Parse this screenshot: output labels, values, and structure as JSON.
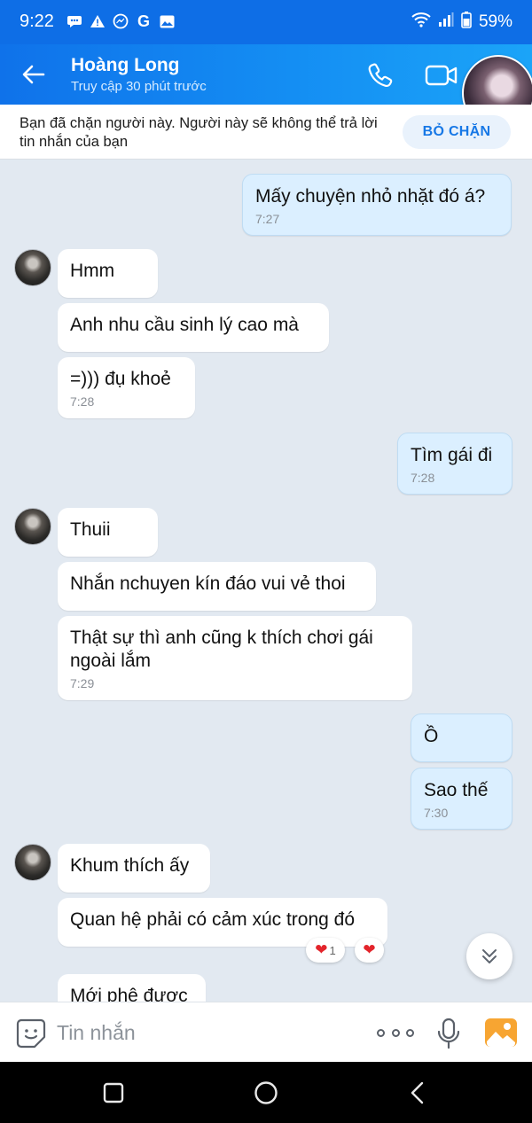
{
  "status": {
    "time": "9:22",
    "battery": "59%",
    "notification_icons": [
      "chat-bubble-icon",
      "warning-icon",
      "messenger-icon",
      "google-icon",
      "image-icon"
    ]
  },
  "header": {
    "name": "Hoàng Long",
    "status": "Truy cập 30 phút trước"
  },
  "banner": {
    "text": "Bạn đã chặn người này. Người này sẽ không thể trả lời tin nhắn của bạn",
    "button": "BỎ CHẶN"
  },
  "messages": [
    {
      "text": "Mấy chuyện nhỏ nhặt đó á?",
      "time": "7:27",
      "dir": "out"
    },
    {
      "text": "Hmm",
      "time": "",
      "dir": "in"
    },
    {
      "text": "Anh nhu cầu sinh lý cao mà",
      "time": "",
      "dir": "in"
    },
    {
      "text": "=))) đụ khoẻ",
      "time": "7:28",
      "dir": "in"
    },
    {
      "text": "Tìm gái đi",
      "time": "7:28",
      "dir": "out"
    },
    {
      "text": "Thuii",
      "time": "",
      "dir": "in"
    },
    {
      "text": "Nhắn nchuyen kín đáo vui vẻ thoi",
      "time": "",
      "dir": "in"
    },
    {
      "text": "Thật sự thì anh cũng k thích chơi gái ngoài lắm",
      "time": "7:29",
      "dir": "in"
    },
    {
      "text": "Ồ",
      "time": "",
      "dir": "out"
    },
    {
      "text": "Sao thế",
      "time": "7:30",
      "dir": "out"
    },
    {
      "text": "Khum thích ấy",
      "time": "",
      "dir": "in"
    },
    {
      "text": "Quan hệ phải có cảm xúc trong đó",
      "time": "",
      "dir": "in"
    },
    {
      "text": "Mới phê được",
      "time": "",
      "dir": "in"
    }
  ],
  "reactions": {
    "heart_count": "1"
  },
  "input": {
    "placeholder": "Tin nhắn"
  },
  "colors": {
    "header": "#0f72ea",
    "accent": "#1778e6",
    "bubble_out": "#dbefff",
    "chat_bg": "#e2e9f1"
  }
}
